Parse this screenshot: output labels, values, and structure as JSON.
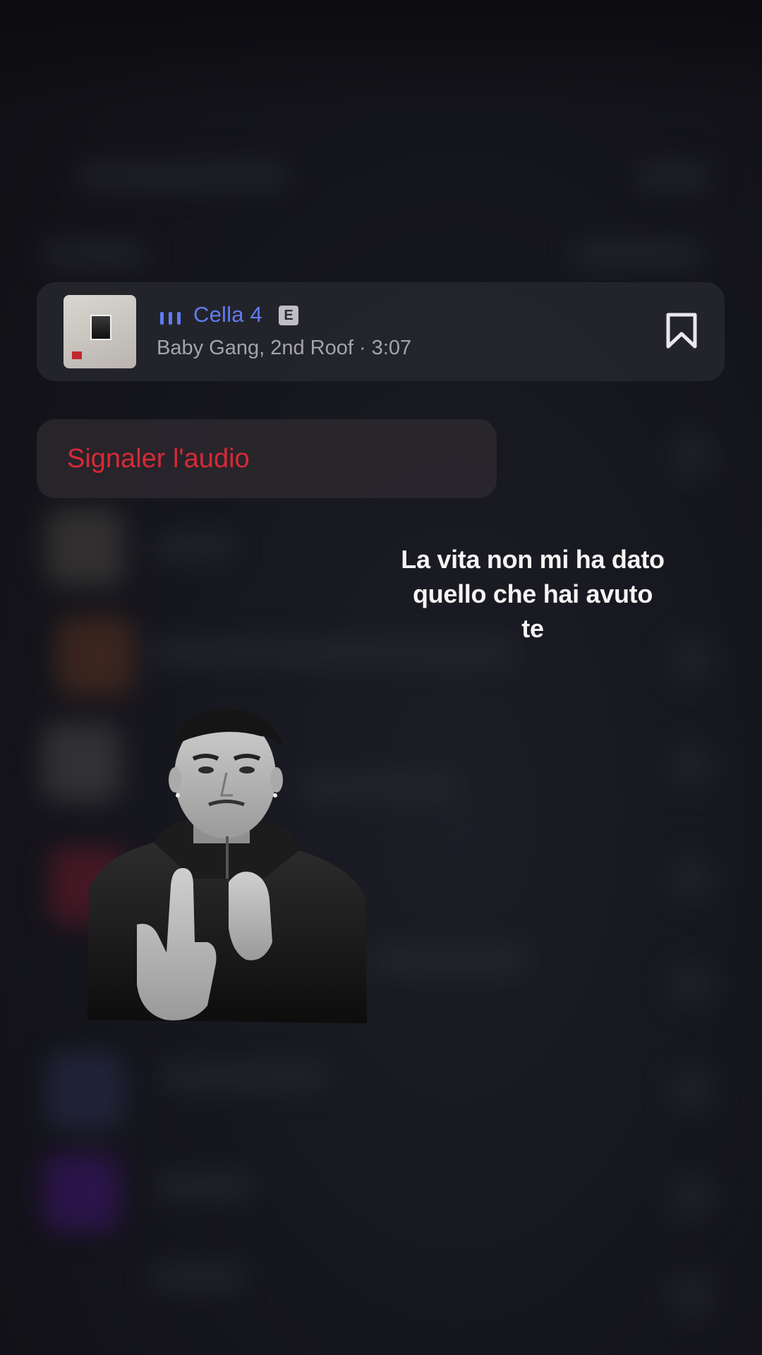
{
  "audio_card": {
    "title": "Cella 4",
    "explicit_badge": "E",
    "meta": "Baby Gang, 2nd Roof · 3:07",
    "accent_color": "#5e7df0",
    "album_art_icon": "album-cover-art",
    "bookmark_icon": "bookmark-icon",
    "playing_icon": "equalizer-bars-icon"
  },
  "report": {
    "label": "Signaler l'audio",
    "color": "#d72a36"
  },
  "lyrics": {
    "lines": [
      "La vita non mi ha dato",
      "quello che hai avuto",
      "te"
    ]
  },
  "sticker": {
    "icon": "person-sticker-grayscale"
  }
}
